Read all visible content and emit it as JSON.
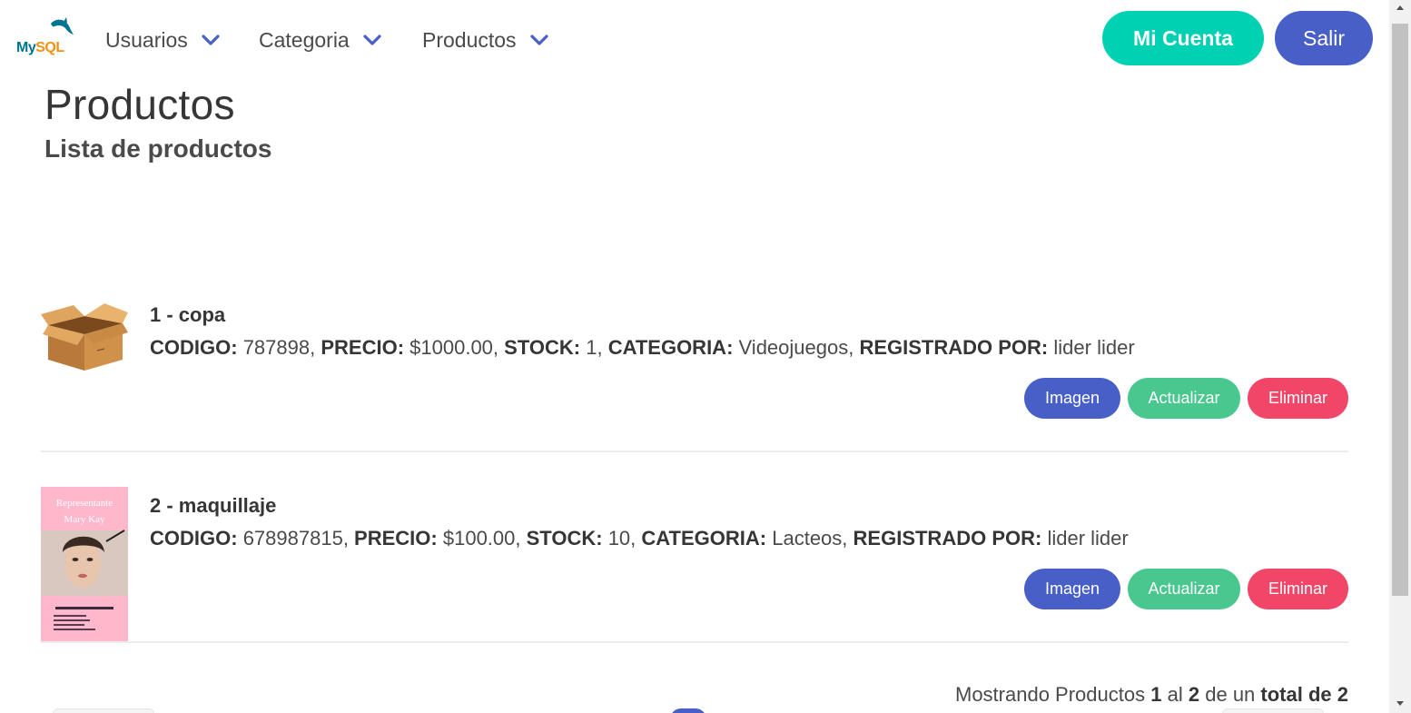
{
  "brand": {
    "logo_my": "My",
    "logo_sql": "SQL"
  },
  "nav": {
    "items": [
      {
        "label": "Usuarios",
        "icon": "chevron-down-icon"
      },
      {
        "label": "Categoria",
        "icon": "chevron-down-icon"
      },
      {
        "label": "Productos",
        "icon": "chevron-down-icon"
      }
    ],
    "account_label": "Mi Cuenta",
    "exit_label": "Salir"
  },
  "header": {
    "title": "Productos",
    "subtitle": "Lista de productos"
  },
  "fields": {
    "code": "CODIGO:",
    "price": "PRECIO:",
    "stock": "STOCK:",
    "category": "CATEGORIA:",
    "registered_by": "REGISTRADO POR:"
  },
  "products": [
    {
      "name": "1 - copa",
      "code": "787898",
      "price": "$1000.00",
      "stock": "1",
      "category": "Videojuegos",
      "registered_by": "lider lider",
      "image": "cardboard-box-icon"
    },
    {
      "name": "2 - maquillaje",
      "code": "678987815",
      "price": "$100.00",
      "stock": "10",
      "category": "Lacteos",
      "registered_by": "lider lider",
      "image": "makeup-flyer-image",
      "image_text": {
        "line1": "Representante",
        "line2": "Mary Kay"
      }
    }
  ],
  "actions": {
    "image_label": "Imagen",
    "update_label": "Actualizar",
    "delete_label": "Eliminar"
  },
  "summary": {
    "prefix": "Mostrando Productos",
    "from": "1",
    "mid": "al",
    "to": "2",
    "of": "de un",
    "total_label": "total de 2"
  },
  "colors": {
    "primary": "#485fc7",
    "account": "#00d1b2",
    "success": "#48c78e",
    "danger": "#f14668"
  }
}
